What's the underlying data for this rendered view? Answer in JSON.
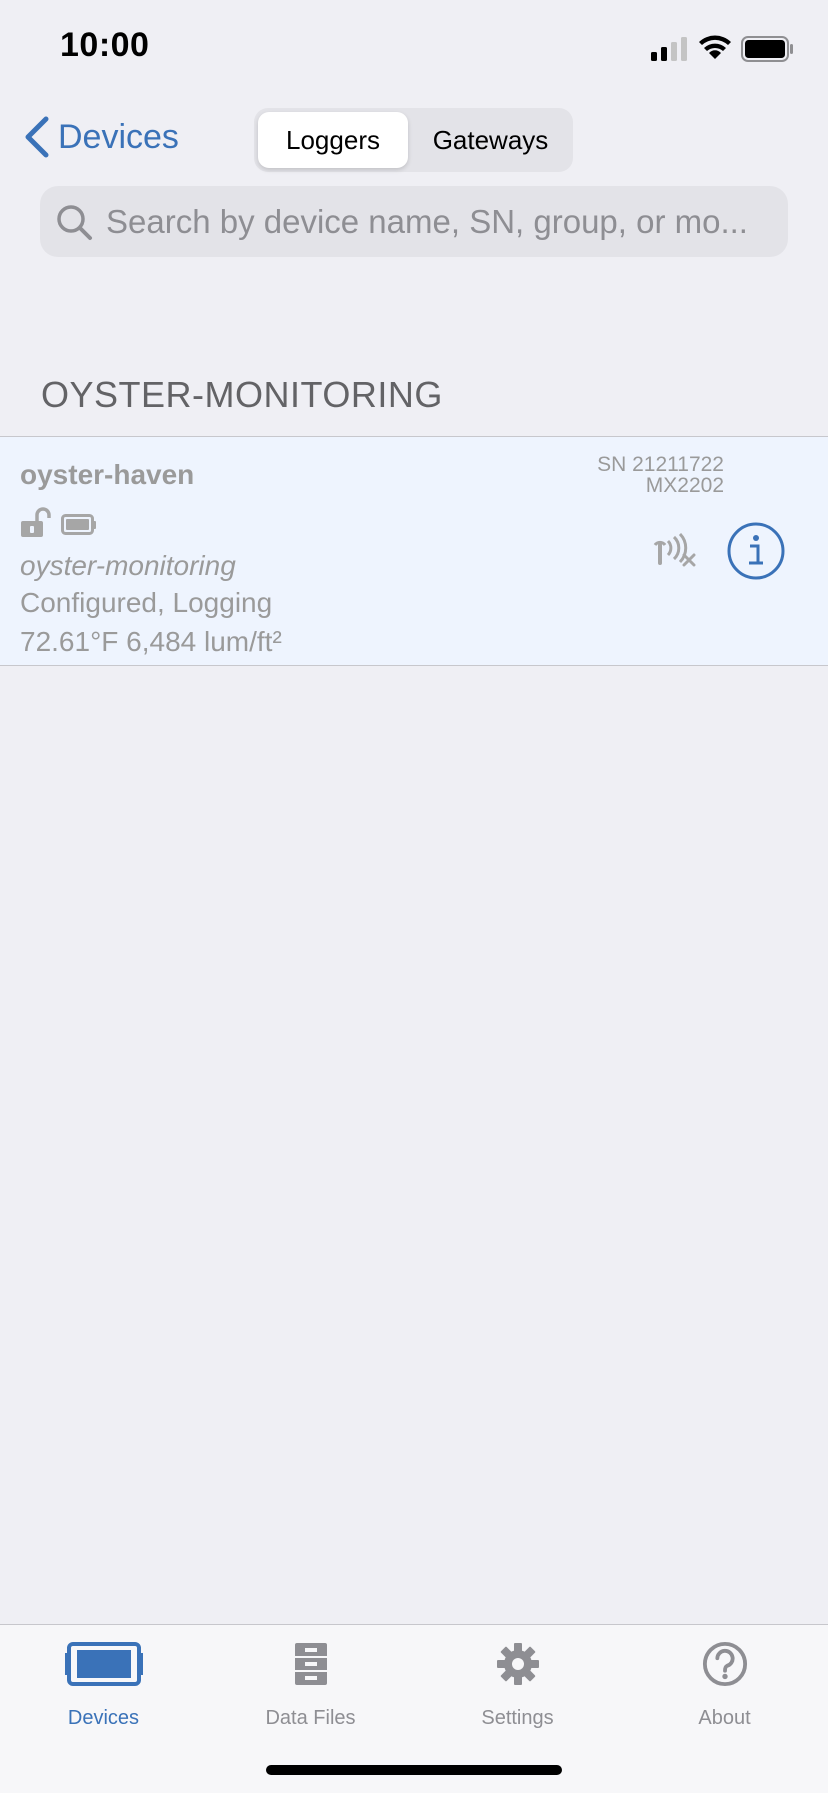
{
  "status_bar": {
    "time": "10:00"
  },
  "nav": {
    "back_label": "Devices",
    "segments": [
      "Loggers",
      "Gateways"
    ],
    "selected_segment": "Loggers"
  },
  "search": {
    "placeholder": "Search by device name, SN, group, or mo..."
  },
  "section": {
    "title": "OYSTER-MONITORING"
  },
  "device": {
    "name": "oyster-haven",
    "sn": "SN 21211722",
    "model": "MX2202",
    "group": "oyster-monitoring",
    "status": "Configured, Logging",
    "readings": "72.61°F 6,484 lum/ft²",
    "icons": [
      "unlocked-lock-icon",
      "battery-icon",
      "signal-disconnected-icon",
      "info-icon"
    ]
  },
  "tab_bar": {
    "tabs": [
      {
        "label": "Devices",
        "icon": "device-icon"
      },
      {
        "label": "Data Files",
        "icon": "file-cabinet-icon"
      },
      {
        "label": "Settings",
        "icon": "gear-icon"
      },
      {
        "label": "About",
        "icon": "question-icon"
      }
    ],
    "active": "Devices"
  },
  "colors": {
    "accent": "#3a72b8",
    "background": "#efeff4",
    "card": "#eef4fe",
    "muted": "#9a9a9a"
  }
}
